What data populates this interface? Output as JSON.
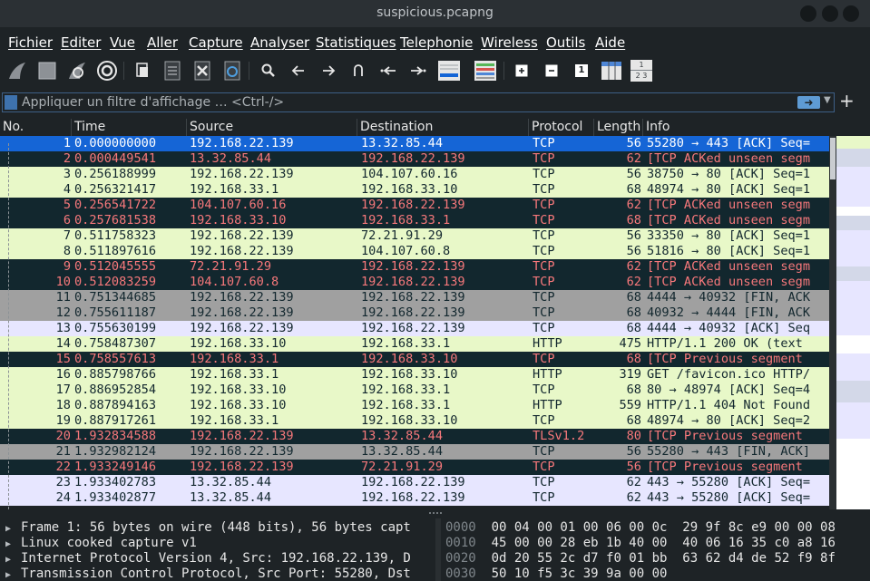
{
  "window": {
    "title": "suspicious.pcapng"
  },
  "menu": [
    "Fichier",
    "Editer",
    "Vue",
    "Aller",
    "Capture",
    "Analyser",
    "Statistiques",
    "Telephonie",
    "Wireless",
    "Outils",
    "Aide"
  ],
  "toolbar": {
    "icons": [
      "shark-fin-start-icon",
      "stop-square-icon",
      "shark-fin-restart-icon",
      "gear-options-icon",
      "open-file-icon",
      "save-file-icon",
      "close-file-icon",
      "reload-file-icon",
      "search-icon",
      "back-arrow-icon",
      "forward-arrow-icon",
      "go-to-packet-icon",
      "first-packet-icon",
      "last-packet-icon",
      "autoscroll-icon",
      "colorize-icon",
      "zoom-in-icon",
      "zoom-out-icon",
      "normal-size-icon",
      "resize-columns-icon",
      "layout-icon"
    ],
    "normal_size_label": "1",
    "layout_top": "1",
    "layout_bottom": "2 3"
  },
  "filter": {
    "placeholder": "Appliquer un filtre d'affichage … <Ctrl-/>"
  },
  "columns": {
    "no": "No.",
    "time": "Time",
    "source": "Source",
    "destination": "Destination",
    "protocol": "Protocol",
    "length": "Length",
    "info": "Info"
  },
  "colors": {
    "selected_bg": "#1565d6",
    "selected_fg": "#ffffff",
    "tcp_bg": "#e8f8c8",
    "tcp_fg": "#12272e",
    "bad_bg": "#12272e",
    "bad_fg": "#f7787b",
    "fin_bg": "#a0a0a0",
    "fin_fg": "#12272e",
    "lav_bg": "#e7e6ff",
    "lav_fg": "#12272e"
  },
  "packets": [
    {
      "no": "1",
      "time": "0.000000000",
      "src": "192.168.22.139",
      "dst": "13.32.85.44",
      "proto": "TCP",
      "len": "56",
      "info": "55280 → 443 [ACK] Seq=",
      "style": "sel"
    },
    {
      "no": "2",
      "time": "0.000449541",
      "src": "13.32.85.44",
      "dst": "192.168.22.139",
      "proto": "TCP",
      "len": "62",
      "info": "[TCP ACKed unseen segm",
      "style": "bad"
    },
    {
      "no": "3",
      "time": "0.256188999",
      "src": "192.168.22.139",
      "dst": "104.107.60.16",
      "proto": "TCP",
      "len": "56",
      "info": "38750 → 80 [ACK] Seq=1",
      "style": "tcp"
    },
    {
      "no": "4",
      "time": "0.256321417",
      "src": "192.168.33.1",
      "dst": "192.168.33.10",
      "proto": "TCP",
      "len": "68",
      "info": "48974 → 80 [ACK] Seq=1",
      "style": "tcp"
    },
    {
      "no": "5",
      "time": "0.256541722",
      "src": "104.107.60.16",
      "dst": "192.168.22.139",
      "proto": "TCP",
      "len": "62",
      "info": "[TCP ACKed unseen segm",
      "style": "bad"
    },
    {
      "no": "6",
      "time": "0.257681538",
      "src": "192.168.33.10",
      "dst": "192.168.33.1",
      "proto": "TCP",
      "len": "68",
      "info": "[TCP ACKed unseen segm",
      "style": "bad"
    },
    {
      "no": "7",
      "time": "0.511758323",
      "src": "192.168.22.139",
      "dst": "72.21.91.29",
      "proto": "TCP",
      "len": "56",
      "info": "33350 → 80 [ACK] Seq=1",
      "style": "tcp"
    },
    {
      "no": "8",
      "time": "0.511897616",
      "src": "192.168.22.139",
      "dst": "104.107.60.8",
      "proto": "TCP",
      "len": "56",
      "info": "51816 → 80 [ACK] Seq=1",
      "style": "tcp"
    },
    {
      "no": "9",
      "time": "0.512045555",
      "src": "72.21.91.29",
      "dst": "192.168.22.139",
      "proto": "TCP",
      "len": "62",
      "info": "[TCP ACKed unseen segm",
      "style": "bad"
    },
    {
      "no": "10",
      "time": "0.512083259",
      "src": "104.107.60.8",
      "dst": "192.168.22.139",
      "proto": "TCP",
      "len": "62",
      "info": "[TCP ACKed unseen segm",
      "style": "bad"
    },
    {
      "no": "11",
      "time": "0.751344685",
      "src": "192.168.22.139",
      "dst": "192.168.22.139",
      "proto": "TCP",
      "len": "68",
      "info": "4444 → 40932 [FIN, ACK",
      "style": "fin"
    },
    {
      "no": "12",
      "time": "0.755611187",
      "src": "192.168.22.139",
      "dst": "192.168.22.139",
      "proto": "TCP",
      "len": "68",
      "info": "40932 → 4444 [FIN, ACK",
      "style": "fin"
    },
    {
      "no": "13",
      "time": "0.755630199",
      "src": "192.168.22.139",
      "dst": "192.168.22.139",
      "proto": "TCP",
      "len": "68",
      "info": "4444 → 40932 [ACK] Seq",
      "style": "lav"
    },
    {
      "no": "14",
      "time": "0.758487307",
      "src": "192.168.33.10",
      "dst": "192.168.33.1",
      "proto": "HTTP",
      "len": "475",
      "info": "HTTP/1.1 200 OK  (text",
      "style": "tcp"
    },
    {
      "no": "15",
      "time": "0.758557613",
      "src": "192.168.33.1",
      "dst": "192.168.33.10",
      "proto": "TCP",
      "len": "68",
      "info": "[TCP Previous segment",
      "style": "bad"
    },
    {
      "no": "16",
      "time": "0.885798766",
      "src": "192.168.33.1",
      "dst": "192.168.33.10",
      "proto": "HTTP",
      "len": "319",
      "info": "GET /favicon.ico HTTP/",
      "style": "tcp"
    },
    {
      "no": "17",
      "time": "0.886952854",
      "src": "192.168.33.10",
      "dst": "192.168.33.1",
      "proto": "TCP",
      "len": "68",
      "info": "80 → 48974 [ACK] Seq=4",
      "style": "tcp"
    },
    {
      "no": "18",
      "time": "0.887894163",
      "src": "192.168.33.10",
      "dst": "192.168.33.1",
      "proto": "HTTP",
      "len": "559",
      "info": "HTTP/1.1 404 Not Found",
      "style": "tcp"
    },
    {
      "no": "19",
      "time": "0.887917261",
      "src": "192.168.33.1",
      "dst": "192.168.33.10",
      "proto": "TCP",
      "len": "68",
      "info": "48974 → 80 [ACK] Seq=2",
      "style": "tcp"
    },
    {
      "no": "20",
      "time": "1.932834588",
      "src": "192.168.22.139",
      "dst": "13.32.85.44",
      "proto": "TLSv1.2",
      "len": "80",
      "info": "[TCP Previous segment",
      "style": "bad"
    },
    {
      "no": "21",
      "time": "1.932982124",
      "src": "192.168.22.139",
      "dst": "13.32.85.44",
      "proto": "TCP",
      "len": "56",
      "info": "55280 → 443 [FIN, ACK]",
      "style": "fin"
    },
    {
      "no": "22",
      "time": "1.933249146",
      "src": "192.168.22.139",
      "dst": "72.21.91.29",
      "proto": "TCP",
      "len": "56",
      "info": "[TCP Previous segment",
      "style": "bad"
    },
    {
      "no": "23",
      "time": "1.933402783",
      "src": "13.32.85.44",
      "dst": "192.168.22.139",
      "proto": "TCP",
      "len": "62",
      "info": "443 → 55280 [ACK] Seq=",
      "style": "lav"
    },
    {
      "no": "24",
      "time": "1.933402877",
      "src": "13.32.85.44",
      "dst": "192.168.22.139",
      "proto": "TCP",
      "len": "62",
      "info": "443 → 55280 [ACK] Seq=",
      "style": "lav"
    }
  ],
  "details": [
    "Frame 1: 56 bytes on wire (448 bits), 56 bytes capt",
    "Linux cooked capture v1",
    "Internet Protocol Version 4, Src: 192.168.22.139, D",
    "Transmission Control Protocol, Src Port: 55280, Dst"
  ],
  "bytes": [
    {
      "offset": "0000",
      "hex": "00 04 00 01 00 06 00 0c  29 9f 8c e9 00 00 08"
    },
    {
      "offset": "0010",
      "hex": "45 00 00 28 eb 1b 40 00  40 06 16 35 c0 a8 16"
    },
    {
      "offset": "0020",
      "hex": "0d 20 55 2c d7 f0 01 bb  63 62 d4 de 52 f9 8f"
    },
    {
      "offset": "0030",
      "hex": "50 10 f5 3c 39 9a 00 00"
    }
  ]
}
